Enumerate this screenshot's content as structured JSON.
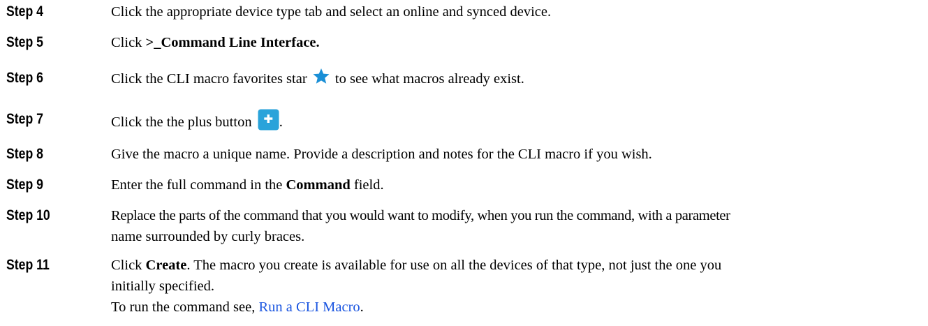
{
  "steps": [
    {
      "label": "Step 4",
      "text": "Click the appropriate device type tab and select an online and synced device."
    },
    {
      "label": "Step 5",
      "pre": "Click ",
      "bold": ">_Command Line Interface."
    },
    {
      "label": "Step 6",
      "pre": "Click the CLI macro favorites star ",
      "post": " to see what macros already exist.",
      "icon": "star-icon"
    },
    {
      "label": "Step 7",
      "pre": "Click the the plus button ",
      "post": ".",
      "icon": "plus-button-icon"
    },
    {
      "label": "Step 8",
      "text": "Give the macro a unique name. Provide a description and notes for the CLI macro if you wish."
    },
    {
      "label": "Step 9",
      "pre": "Enter the full command in the ",
      "bold": "Command",
      "post": " field."
    },
    {
      "label": "Step 10",
      "line1": "Replace the parts of the command that you would want to modify, when you run the command, with a parameter",
      "line2": "name surrounded by curly braces."
    },
    {
      "label": "Step 11",
      "pre": "Click ",
      "bold": "Create",
      "line1_post": ". The macro you create is available for use on all the devices of that type, not just the one you",
      "line2": "initially specified."
    }
  ],
  "footer": {
    "pre": "To run the command see, ",
    "link": "Run a CLI Macro",
    "post": "."
  },
  "colors": {
    "star": "#1a8fd6",
    "plus_button": "#2aa3da",
    "link": "#1a55e0"
  }
}
